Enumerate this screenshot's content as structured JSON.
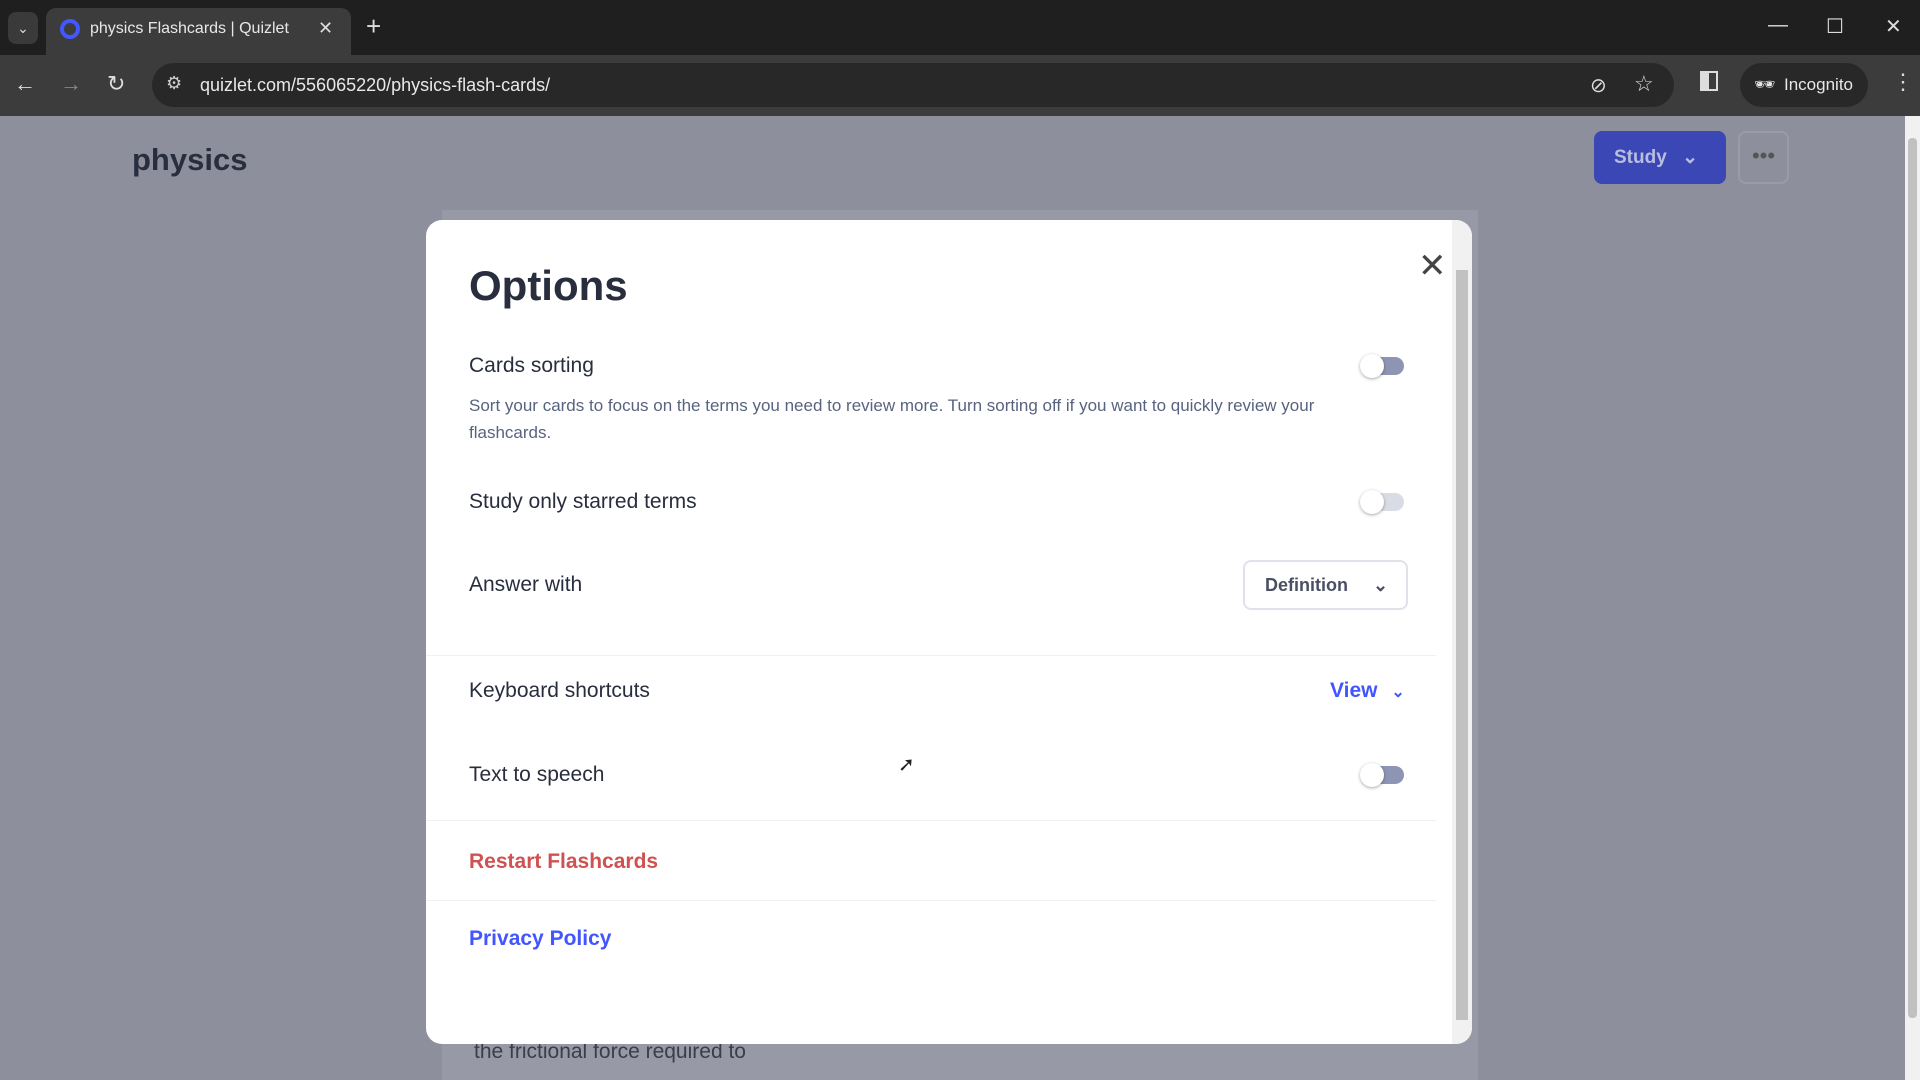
{
  "browser": {
    "tab_title": "physics Flashcards | Quizlet",
    "url": "quizlet.com/556065220/physics-flash-cards/",
    "profile_label": "Incognito",
    "icons": [
      "tab-search-icon",
      "quizlet-favicon",
      "close-icon",
      "plus-icon",
      "minimize-icon",
      "maximize-icon",
      "close-icon",
      "back-icon",
      "forward-icon",
      "reload-icon",
      "site-settings-icon",
      "eye-off-icon",
      "star-icon",
      "side-panel-icon",
      "incognito-icon",
      "kebab-menu-icon"
    ]
  },
  "page": {
    "title": "physics",
    "study_label": "Study",
    "more_label": "•••",
    "card_text": "the frictional force required to"
  },
  "modal": {
    "title": "Options",
    "cards_sorting": {
      "label": "Cards sorting",
      "description": "Sort your cards to focus on the terms you need to review more. Turn sorting off if you want to quickly review your flashcards.",
      "enabled": false
    },
    "starred": {
      "label": "Study only starred terms",
      "enabled": false
    },
    "answer_with": {
      "label": "Answer with",
      "value": "Definition"
    },
    "keyboard": {
      "label": "Keyboard shortcuts",
      "action": "View"
    },
    "tts": {
      "label": "Text to speech",
      "enabled": false
    },
    "restart": "Restart Flashcards",
    "privacy": "Privacy Policy"
  },
  "colors": {
    "accent": "#4255ff",
    "study_button": "#3a47b5",
    "danger": "#d05151",
    "overlay": "#8e8f9c"
  }
}
